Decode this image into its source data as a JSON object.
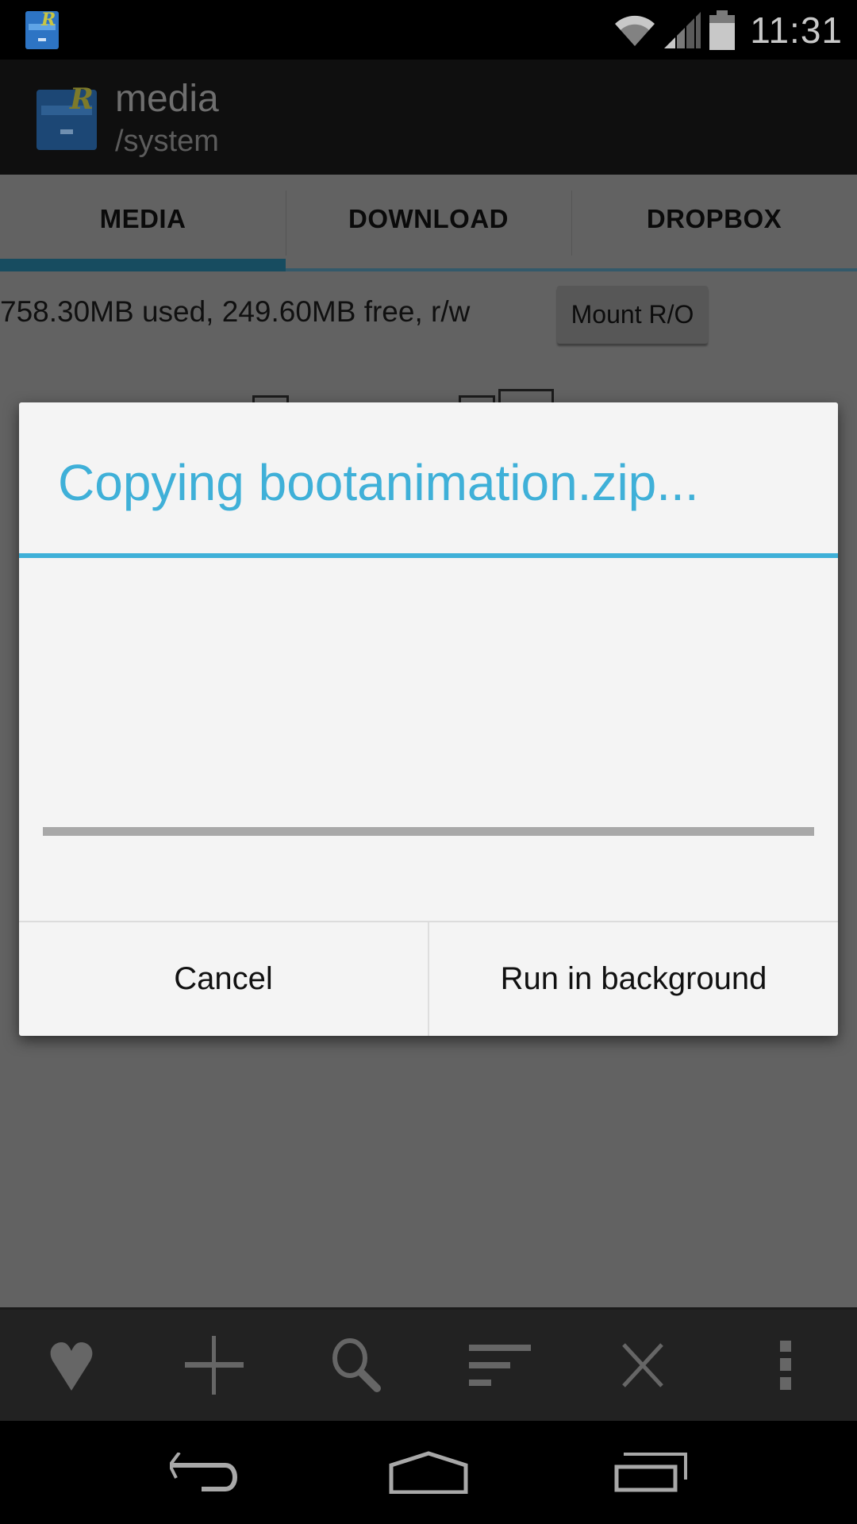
{
  "status_bar": {
    "time": "11:31",
    "icons": [
      "root-explorer-notification-icon",
      "wifi-icon",
      "signal-icon",
      "battery-icon"
    ]
  },
  "action_bar": {
    "app_icon": "root-explorer-logo-icon",
    "title": "media",
    "subtitle": "/system"
  },
  "tabs": [
    {
      "label": "MEDIA",
      "active": true
    },
    {
      "label": "DOWNLOAD",
      "active": false
    },
    {
      "label": "DROPBOX",
      "active": false
    }
  ],
  "storage": {
    "info": "758.30MB used, 249.60MB free, r/w",
    "mount_button": "Mount R/O"
  },
  "dialog": {
    "title": "Copying bootanimation.zip...",
    "progress_percent": 0,
    "buttons": {
      "cancel": "Cancel",
      "background": "Run in background"
    }
  },
  "toolbar": {
    "items": [
      {
        "icon": "heart-icon",
        "label": "Bookmarks"
      },
      {
        "icon": "plus-icon",
        "label": "New"
      },
      {
        "icon": "search-icon",
        "label": "Search"
      },
      {
        "icon": "sort-icon",
        "label": "Sort"
      },
      {
        "icon": "close-icon",
        "label": "Close"
      },
      {
        "icon": "overflow-menu-icon",
        "label": "More"
      }
    ]
  },
  "nav_bar": {
    "items": [
      "back-icon",
      "home-icon",
      "recents-icon"
    ]
  },
  "colors": {
    "accent": "#3fb0d8",
    "tab_indicator": "#174c60",
    "dialog_bg": "#f4f4f4",
    "scrim_bg": "#626262"
  }
}
